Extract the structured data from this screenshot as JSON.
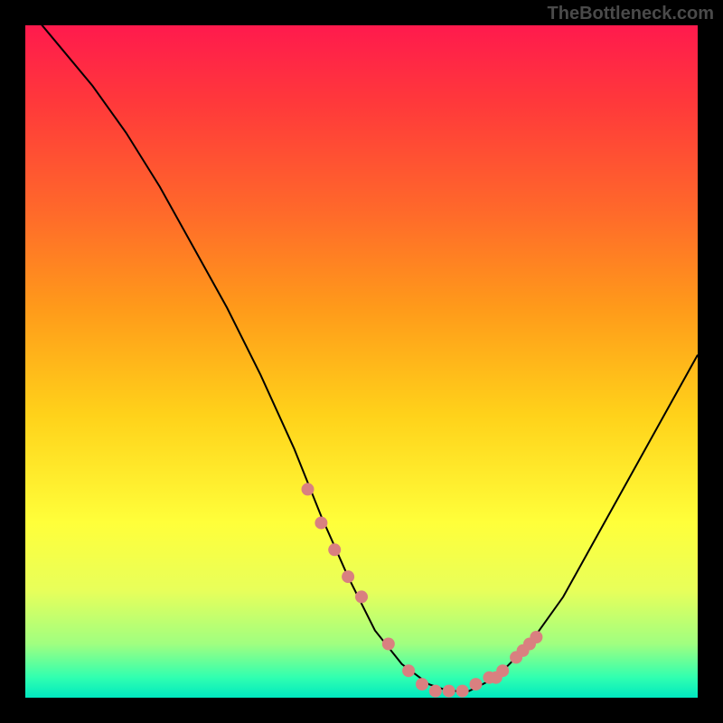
{
  "watermark": "TheBottleneck.com",
  "chart_data": {
    "type": "line",
    "title": "",
    "xlabel": "",
    "ylabel": "",
    "xlim": [
      0,
      100
    ],
    "ylim": [
      0,
      100
    ],
    "series": [
      {
        "name": "curve",
        "x": [
          0,
          5,
          10,
          15,
          20,
          25,
          30,
          35,
          40,
          44,
          48,
          52,
          56,
          60,
          63,
          66,
          70,
          75,
          80,
          85,
          90,
          95,
          100
        ],
        "values": [
          103,
          97,
          91,
          84,
          76,
          67,
          58,
          48,
          37,
          27,
          18,
          10,
          5,
          2,
          1,
          1,
          3,
          8,
          15,
          24,
          33,
          42,
          51
        ]
      }
    ],
    "markers": {
      "name": "dots",
      "color": "#d98080",
      "x": [
        42,
        44,
        46,
        48,
        50,
        54,
        57,
        59,
        61,
        63,
        65,
        67,
        69,
        70,
        71,
        73,
        74,
        75,
        76
      ],
      "values": [
        31,
        26,
        22,
        18,
        15,
        8,
        4,
        2,
        1,
        1,
        1,
        2,
        3,
        3,
        4,
        6,
        7,
        8,
        9
      ]
    }
  }
}
